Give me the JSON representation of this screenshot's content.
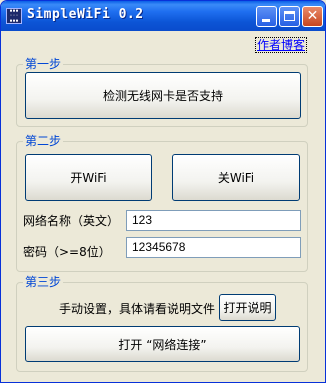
{
  "window": {
    "title": "SimpleWiFi 0.2",
    "icon_glyph": "!!!!\n(((\nwifi"
  },
  "author_link": "作者博客",
  "step1": {
    "label": "第一步",
    "detect_button": "检测无线网卡是否支持"
  },
  "step2": {
    "label": "第二步",
    "wifi_on_button": "开WiFi",
    "wifi_off_button": "关WiFi",
    "ssid_label": "网络名称（英文）",
    "ssid_value": "123",
    "password_label": "密码（>=8位）",
    "password_value": "12345678"
  },
  "step3": {
    "label": "第三步",
    "manual_text": "手动设置，具体请看说明文件",
    "open_doc_button": "打开说明",
    "open_network_button": "打开 “网络连接”"
  }
}
